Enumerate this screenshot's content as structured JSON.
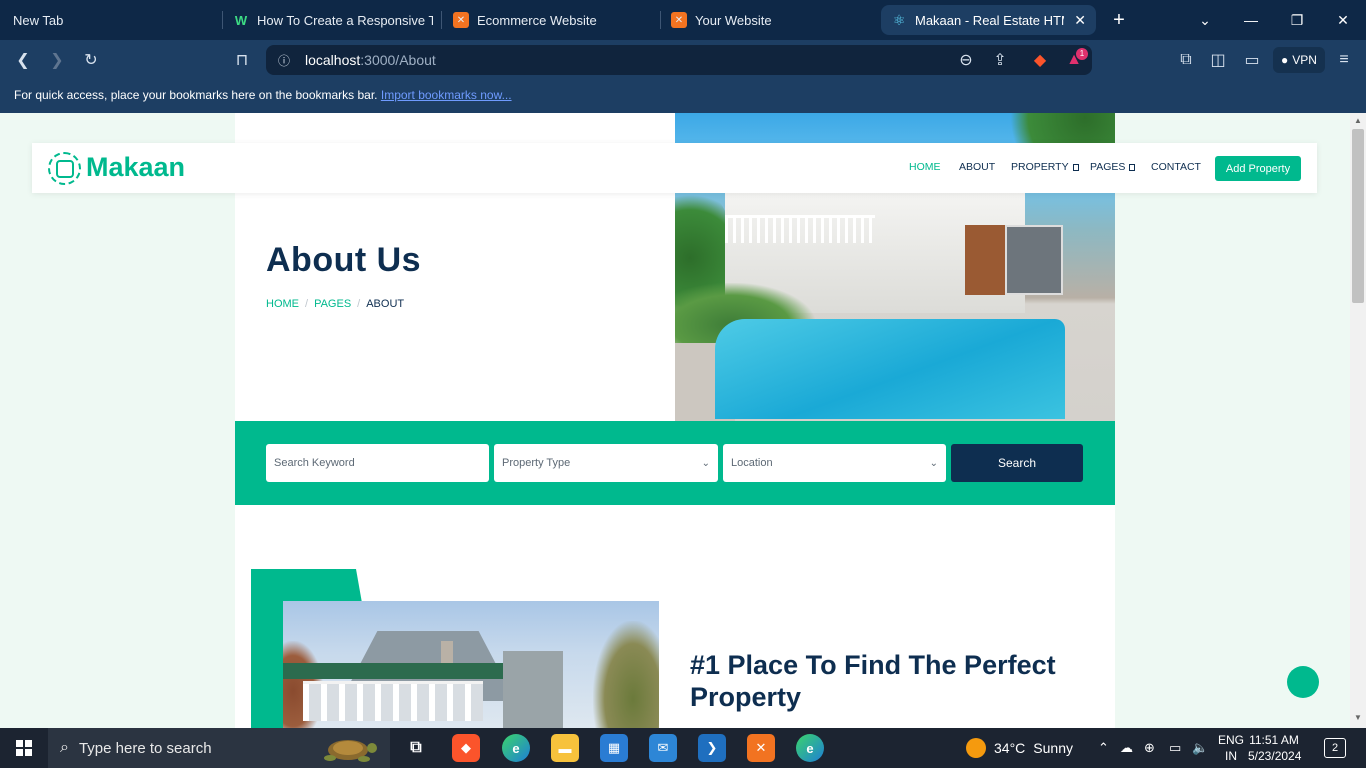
{
  "browser": {
    "tabs": [
      {
        "title": "New Tab"
      },
      {
        "title": "How To Create a Responsive Top"
      },
      {
        "title": "Ecommerce Website"
      },
      {
        "title": "Your Website"
      },
      {
        "title": "Makaan - Real Estate HTML"
      }
    ],
    "url_host": "localhost",
    "url_path": ":3000/About",
    "vpn_label": "VPN",
    "brave_badge": "1",
    "bookmarks_text": "For quick access, place your bookmarks here on the bookmarks bar.",
    "bookmarks_link": "Import bookmarks now..."
  },
  "navbar": {
    "logo": "Makaan",
    "links": [
      "HOME",
      "ABOUT",
      "PROPERTY",
      "PAGES",
      "CONTACT"
    ],
    "cta": "Add Property"
  },
  "hero": {
    "title": "About Us",
    "breadcrumb": [
      "HOME",
      "PAGES",
      "ABOUT"
    ]
  },
  "search": {
    "keyword_placeholder": "Search Keyword",
    "type_value": "Property Type",
    "location_value": "Location",
    "button": "Search"
  },
  "about": {
    "heading": "#1 Place To Find The Perfect Property"
  },
  "taskbar": {
    "search_placeholder": "Type here to search",
    "temperature": "34°C",
    "condition": "Sunny",
    "lang_top": "ENG",
    "lang_bottom": "IN",
    "time": "11:51 AM",
    "date": "5/23/2024",
    "notifications": "2"
  },
  "colors": {
    "accent": "#00b98e",
    "navy": "#0e2e50",
    "chrome_dark": "#0e2847",
    "chrome": "#1d3e63"
  }
}
